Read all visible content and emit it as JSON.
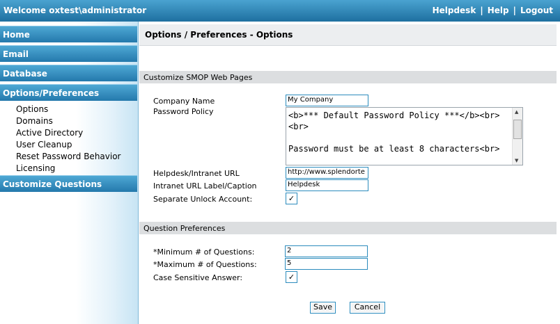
{
  "topbar": {
    "welcome": "Welcome oxtest\\administrator",
    "links": [
      "Helpdesk",
      "Help",
      "Logout"
    ],
    "separator": "|"
  },
  "sidebar": {
    "home": "Home",
    "email": "Email",
    "database": "Database",
    "options_preferences": "Options/Preferences",
    "sub_items": [
      "Options",
      "Domains",
      "Active Directory",
      "User Cleanup",
      "Reset Password Behavior",
      "Licensing"
    ],
    "customize_questions": "Customize Questions"
  },
  "main": {
    "page_title": "Options / Preferences - Options",
    "customize_section": {
      "title": "Customize SMOP Web Pages",
      "company_name_label": "Company Name",
      "company_name_value": "My Company",
      "password_policy_label": "Password Policy",
      "password_policy_value": "<b>*** Default Password Policy ***</b><br><br>\n\nPassword must be at least 8 characters<br>",
      "helpdesk_url_label": "Helpdesk/Intranet URL",
      "helpdesk_url_value": "http://www.splendorte",
      "intranet_caption_label": "Intranet URL Label/Caption",
      "intranet_caption_value": "Helpdesk",
      "separate_unlock_label": "Separate Unlock Account:",
      "separate_unlock_checked": "✓"
    },
    "question_section": {
      "title": "Question Preferences",
      "min_questions_label": "*Minimum # of Questions:",
      "min_questions_value": "2",
      "max_questions_label": "*Maximum # of Questions:",
      "max_questions_value": "5",
      "case_sensitive_label": "Case Sensitive Answer:",
      "case_sensitive_checked": "✓"
    },
    "buttons": {
      "save": "Save",
      "cancel": "Cancel"
    }
  },
  "icons": {
    "scroll_up": "scroll-up-arrow-icon",
    "scroll_down": "scroll-down-arrow-icon",
    "checkmark": "checkmark-icon"
  },
  "colors": {
    "header_blue": "#2479ac",
    "border_blue": "#2b8bbd",
    "section_gray": "#dcdee0"
  }
}
